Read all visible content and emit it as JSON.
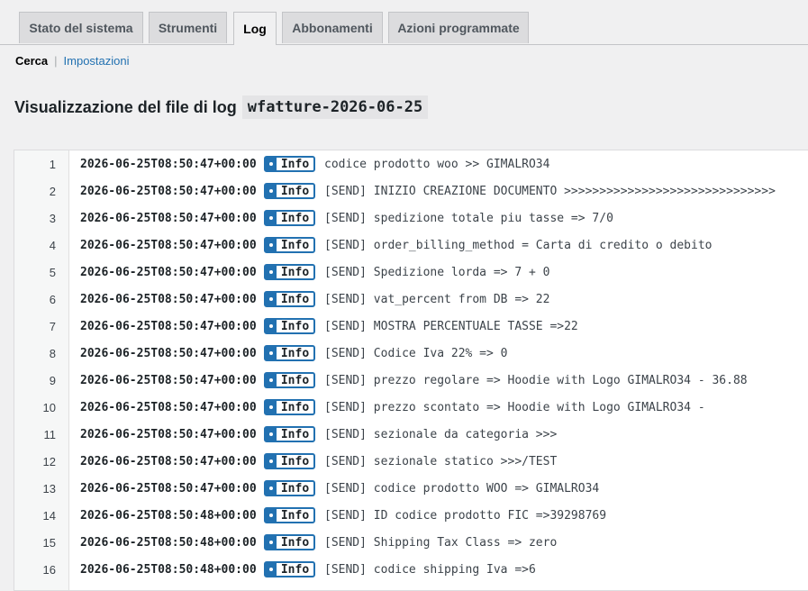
{
  "tabs": [
    {
      "label": "Stato del sistema",
      "active": false
    },
    {
      "label": "Strumenti",
      "active": false
    },
    {
      "label": "Log",
      "active": true
    },
    {
      "label": "Abbonamenti",
      "active": false
    },
    {
      "label": "Azioni programmate",
      "active": false
    }
  ],
  "subnav": {
    "current": "Cerca",
    "separator": "|",
    "link": "Impostazioni"
  },
  "heading": {
    "prefix": "Visualizzazione del file di log",
    "filename": "wfatture-2026-06-25"
  },
  "level_label": "Info",
  "colors": {
    "accent": "#2271b1",
    "background": "#f0f0f1"
  },
  "log_lines": [
    {
      "n": "1",
      "ts": "2026-06-25T08:50:47+00:00",
      "msg": "codice prodotto woo >> GIMALRO34"
    },
    {
      "n": "2",
      "ts": "2026-06-25T08:50:47+00:00",
      "msg": "[SEND] INIZIO CREAZIONE DOCUMENTO >>>>>>>>>>>>>>>>>>>>>>>>>>>>>>"
    },
    {
      "n": "3",
      "ts": "2026-06-25T08:50:47+00:00",
      "msg": "[SEND] spedizione totale piu tasse => 7/0"
    },
    {
      "n": "4",
      "ts": "2026-06-25T08:50:47+00:00",
      "msg": "[SEND] order_billing_method = Carta di credito o debito"
    },
    {
      "n": "5",
      "ts": "2026-06-25T08:50:47+00:00",
      "msg": "[SEND] Spedizione lorda => 7 + 0"
    },
    {
      "n": "6",
      "ts": "2026-06-25T08:50:47+00:00",
      "msg": "[SEND] vat_percent from DB => 22"
    },
    {
      "n": "7",
      "ts": "2026-06-25T08:50:47+00:00",
      "msg": "[SEND] MOSTRA PERCENTUALE TASSE =>22"
    },
    {
      "n": "8",
      "ts": "2026-06-25T08:50:47+00:00",
      "msg": "[SEND] Codice Iva 22% => 0"
    },
    {
      "n": "9",
      "ts": "2026-06-25T08:50:47+00:00",
      "msg": "[SEND] prezzo regolare => Hoodie with Logo GIMALRO34 - 36.88"
    },
    {
      "n": "10",
      "ts": "2026-06-25T08:50:47+00:00",
      "msg": "[SEND] prezzo scontato => Hoodie with Logo GIMALRO34 -"
    },
    {
      "n": "11",
      "ts": "2026-06-25T08:50:47+00:00",
      "msg": "[SEND] sezionale da categoria >>>"
    },
    {
      "n": "12",
      "ts": "2026-06-25T08:50:47+00:00",
      "msg": "[SEND] sezionale statico >>>/TEST"
    },
    {
      "n": "13",
      "ts": "2026-06-25T08:50:47+00:00",
      "msg": "[SEND] codice prodotto WOO => GIMALRO34"
    },
    {
      "n": "14",
      "ts": "2026-06-25T08:50:48+00:00",
      "msg": "[SEND] ID codice prodotto FIC =>39298769"
    },
    {
      "n": "15",
      "ts": "2026-06-25T08:50:48+00:00",
      "msg": "[SEND] Shipping Tax Class => zero"
    },
    {
      "n": "16",
      "ts": "2026-06-25T08:50:48+00:00",
      "msg": "[SEND] codice shipping Iva =>6"
    }
  ]
}
